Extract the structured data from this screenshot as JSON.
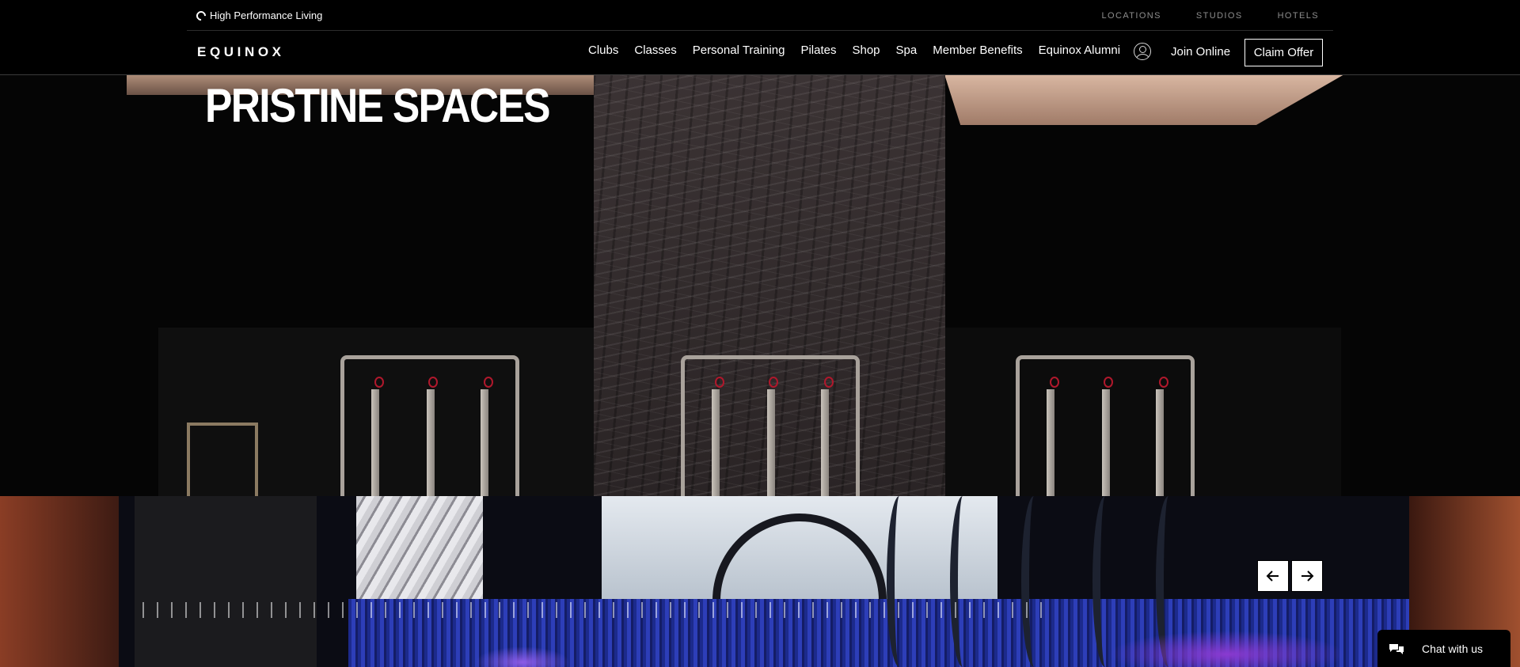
{
  "utility": {
    "tagline": "High Performance Living",
    "links": [
      "LOCATIONS",
      "STUDIOS",
      "HOTELS"
    ]
  },
  "header": {
    "logo": "EQUINOX",
    "nav": [
      "Clubs",
      "Classes",
      "Personal Training",
      "Pilates",
      "Shop",
      "Spa",
      "Member Benefits",
      "Equinox Alumni"
    ],
    "account_icon": "user-circle-icon",
    "join_online": "Join Online",
    "claim_offer": "Claim Offer"
  },
  "hero": {
    "title": "PRISTINE SPACES"
  },
  "carousel": {
    "prev_icon": "arrow-left-icon",
    "next_icon": "arrow-right-icon"
  },
  "chat": {
    "label": "Chat with us",
    "icon": "chat-bubbles-icon"
  },
  "colors": {
    "background": "#000000",
    "text": "#ffffff",
    "muted": "#8d8d8d"
  }
}
